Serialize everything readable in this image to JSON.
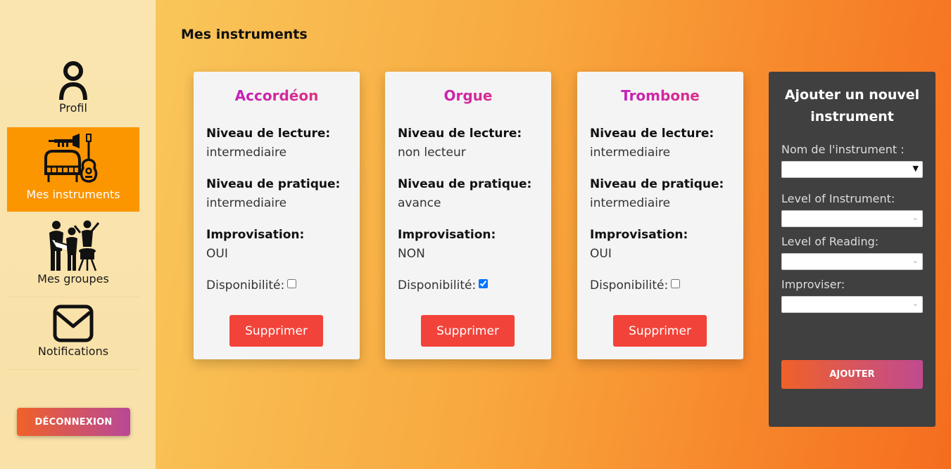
{
  "sidebar": {
    "items": [
      {
        "label": "Profil",
        "icon": "person-icon"
      },
      {
        "label": "Mes instruments",
        "icon": "instruments-icon"
      },
      {
        "label": "Mes groupes",
        "icon": "band-icon"
      },
      {
        "label": "Notifications",
        "icon": "envelope-icon"
      }
    ],
    "logout_label": "DÉCONNEXION"
  },
  "main": {
    "title": "Mes instruments",
    "cards": [
      {
        "name": "Accordéon",
        "reading_label": "Niveau de lecture:",
        "reading_value": "intermediaire",
        "practice_label": "Niveau de pratique:",
        "practice_value": "intermediaire",
        "improv_label": "Improvisation:",
        "improv_value": "OUI",
        "dispo_label": "Disponibilité:",
        "dispo_checked": false,
        "delete_label": "Supprimer"
      },
      {
        "name": "Orgue",
        "reading_label": "Niveau de lecture:",
        "reading_value": "non lecteur",
        "practice_label": "Niveau de pratique:",
        "practice_value": "avance",
        "improv_label": "Improvisation:",
        "improv_value": "NON",
        "dispo_label": "Disponibilité:",
        "dispo_checked": true,
        "delete_label": "Supprimer"
      },
      {
        "name": "Trombone",
        "reading_label": "Niveau de lecture:",
        "reading_value": "intermediaire",
        "practice_label": "Niveau de pratique:",
        "practice_value": "intermediaire",
        "improv_label": "Improvisation:",
        "improv_value": "OUI",
        "dispo_label": "Disponibilité:",
        "dispo_checked": false,
        "delete_label": "Supprimer"
      }
    ],
    "add_panel": {
      "title": "Ajouter un nouvel instrument",
      "instrument_label": "Nom de l'instrument :",
      "level_instrument_label": "Level of Instrument:",
      "level_reading_label": "Level of Reading:",
      "improviser_label": "Improviser:",
      "submit_label": "AJOUTER"
    }
  },
  "colors": {
    "active_nav": "#fb9500",
    "delete_button": "#f2433a",
    "panel_bg": "#404040",
    "card_bg": "#f4f4f4"
  }
}
